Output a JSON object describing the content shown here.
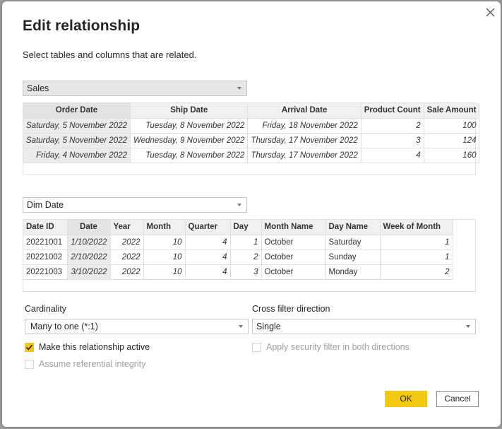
{
  "dialog": {
    "title": "Edit relationship",
    "subtitle": "Select tables and columns that are related.",
    "close_icon": "close-icon"
  },
  "table1": {
    "selected_table": "Sales",
    "columns": [
      "Order Date",
      "Ship Date",
      "Arrival Date",
      "Product Count",
      "Sale Amount"
    ],
    "selected_column": "Order Date",
    "rows": [
      [
        "Saturday, 5 November 2022",
        "Tuesday, 8 November 2022",
        "Friday, 18 November 2022",
        "2",
        "100"
      ],
      [
        "Saturday, 5 November 2022",
        "Wednesday, 9 November 2022",
        "Thursday, 17 November 2022",
        "3",
        "124"
      ],
      [
        "Friday, 4 November 2022",
        "Tuesday, 8 November 2022",
        "Thursday, 17 November 2022",
        "4",
        "160"
      ]
    ]
  },
  "table2": {
    "selected_table": "Dim Date",
    "columns": [
      "Date ID",
      "Date",
      "Year",
      "Month",
      "Quarter",
      "Day",
      "Month Name",
      "Day Name",
      "Week of Month"
    ],
    "selected_column": "Date",
    "rows": [
      [
        "20221001",
        "1/10/2022",
        "2022",
        "10",
        "4",
        "1",
        "October",
        "Saturday",
        "1"
      ],
      [
        "20221002",
        "2/10/2022",
        "2022",
        "10",
        "4",
        "2",
        "October",
        "Sunday",
        "1"
      ],
      [
        "20221003",
        "3/10/2022",
        "2022",
        "10",
        "4",
        "3",
        "October",
        "Monday",
        "2"
      ]
    ]
  },
  "cardinality": {
    "label": "Cardinality",
    "value": "Many to one (*:1)"
  },
  "cross_filter": {
    "label": "Cross filter direction",
    "value": "Single"
  },
  "options": {
    "active": {
      "label": "Make this relationship active",
      "checked": true,
      "enabled": true
    },
    "referential": {
      "label": "Assume referential integrity",
      "checked": false,
      "enabled": false
    },
    "security": {
      "label": "Apply security filter in both directions",
      "checked": false,
      "enabled": false
    }
  },
  "buttons": {
    "ok": "OK",
    "cancel": "Cancel"
  },
  "colors": {
    "accent": "#f2c811"
  }
}
